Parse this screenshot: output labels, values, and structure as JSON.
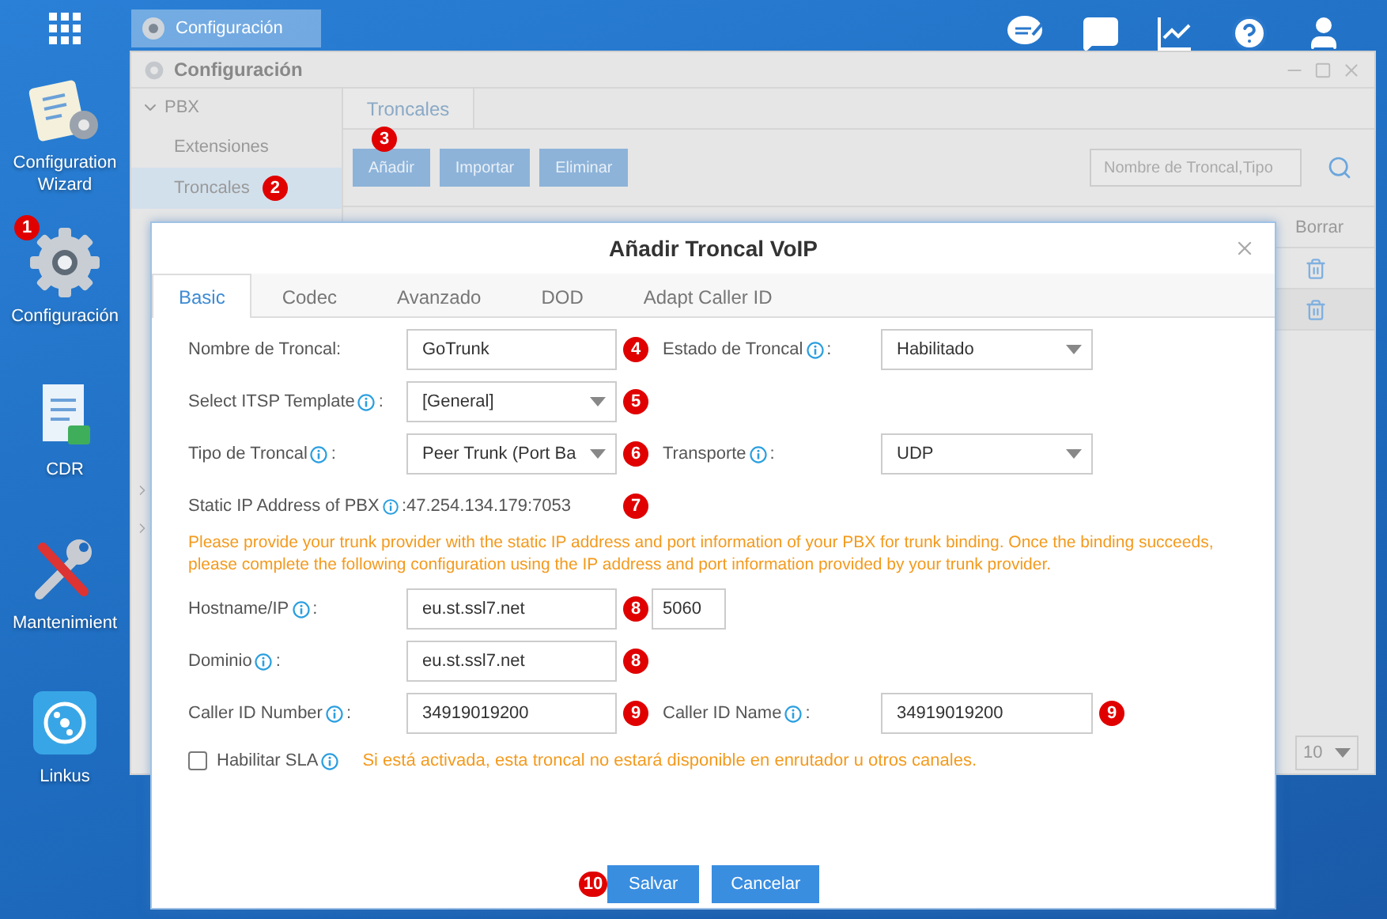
{
  "dock": [
    {
      "kind": "wizard",
      "label": "Configuration Wizard"
    },
    {
      "kind": "gear",
      "label": "Configuración",
      "marker": "1"
    },
    {
      "kind": "cdr",
      "label": "CDR"
    },
    {
      "kind": "tools",
      "label": "Mantenimient"
    },
    {
      "kind": "linkus",
      "label": "Linkus"
    }
  ],
  "taskbar": {
    "title": "Configuración"
  },
  "window": {
    "title": "Configuración",
    "sidebar": {
      "group": "PBX",
      "expanded": true,
      "items": [
        {
          "label": "Extensiones",
          "selected": false
        },
        {
          "label": "Troncales",
          "selected": true,
          "marker": "2"
        }
      ]
    },
    "tabs": [
      {
        "label": "Troncales",
        "selected": true
      }
    ],
    "buttons": [
      {
        "label": "Añadir",
        "marker": "3"
      },
      {
        "label": "Importar"
      },
      {
        "label": "Eliminar"
      }
    ],
    "search": {
      "placeholder": "Nombre de Troncal,Tipo"
    },
    "table": {
      "columns": [
        "Borrar"
      ],
      "rows": [
        {
          "deletable": true
        },
        {
          "deletable": true
        }
      ]
    },
    "pager": {
      "value": "10"
    }
  },
  "dialog": {
    "title": "Añadir Troncal VoIP",
    "tabs": [
      {
        "label": "Basic",
        "selected": true
      },
      {
        "label": "Codec",
        "selected": false
      },
      {
        "label": "Avanzado",
        "selected": false
      },
      {
        "label": "DOD",
        "selected": false
      },
      {
        "label": "Adapt Caller ID",
        "selected": false
      }
    ],
    "rows": [
      {
        "kind": "fields",
        "fields": [
          {
            "kind": "text",
            "label": "Nombre de Troncal:",
            "value": "GoTrunk",
            "marker": "4"
          },
          {
            "kind": "select",
            "label": "Estado de Troncal",
            "info": true,
            "punct": ":",
            "value": "Habilitado"
          }
        ]
      },
      {
        "kind": "fields",
        "fields": [
          {
            "kind": "select",
            "label": "Select ITSP Template",
            "info": true,
            "punct": ":",
            "value": "[General]",
            "marker": "5"
          }
        ]
      },
      {
        "kind": "fields",
        "fields": [
          {
            "kind": "select",
            "label": "Tipo de Troncal",
            "info": true,
            "punct": ":",
            "value": "Peer Trunk (Port Ba",
            "marker": "6"
          },
          {
            "kind": "select",
            "label": "Transporte",
            "info": true,
            "punct": ":",
            "value": "UDP"
          }
        ]
      },
      {
        "kind": "fields",
        "fields": [
          {
            "kind": "static",
            "label": "Static IP Address of PBX",
            "info": true,
            "punct": ":",
            "value": "47.254.134.179:7053",
            "marker": "7"
          }
        ]
      },
      {
        "kind": "note",
        "text": "Please provide your trunk provider with the static IP address and port information of your PBX for trunk binding. Once the binding succeeds, please complete the following configuration using the IP address and port information provided by your trunk provider."
      },
      {
        "kind": "fields",
        "fields": [
          {
            "kind": "text",
            "label": "Hostname/IP",
            "info": true,
            "punct": ":",
            "value": "eu.st.ssl7.net",
            "marker": "8",
            "port": "5060"
          }
        ]
      },
      {
        "kind": "fields",
        "fields": [
          {
            "kind": "text",
            "label": "Dominio",
            "info": true,
            "punct": ":",
            "value": "eu.st.ssl7.net",
            "marker": "8"
          }
        ]
      },
      {
        "kind": "fields",
        "fields": [
          {
            "kind": "text",
            "label": "Caller ID Number",
            "info": true,
            "punct": ":",
            "value": "34919019200",
            "marker": "9"
          },
          {
            "kind": "text",
            "label": "Caller ID Name",
            "info": true,
            "punct": ":",
            "value": "34919019200",
            "marker": "9"
          }
        ]
      },
      {
        "kind": "checkbox",
        "label": "Habilitar SLA",
        "info": true,
        "checked": false,
        "note": "Si está activada, esta troncal no estará disponible en enrutador u otros canales."
      }
    ],
    "buttons": [
      {
        "label": "Salvar",
        "marker": "10"
      },
      {
        "label": "Cancelar"
      }
    ]
  }
}
